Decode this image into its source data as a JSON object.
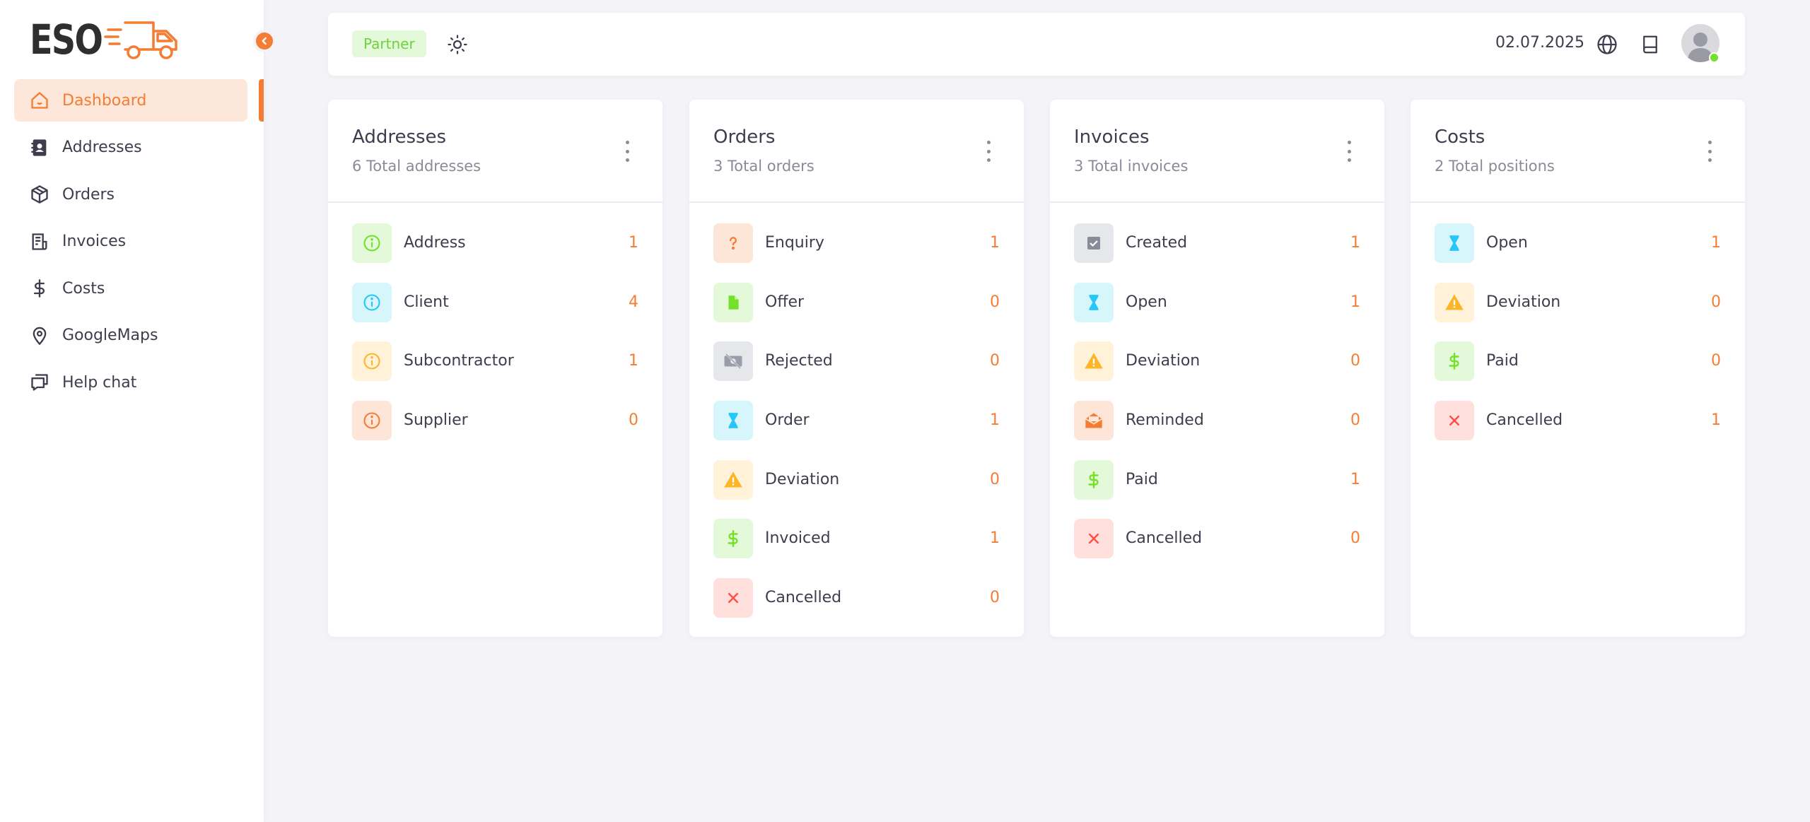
{
  "brand": {
    "name": "ESO",
    "accent": "#f47c33"
  },
  "sidebar": {
    "items": [
      {
        "label": "Dashboard",
        "icon": "home-icon",
        "active": true
      },
      {
        "label": "Addresses",
        "icon": "contacts-book-icon"
      },
      {
        "label": "Orders",
        "icon": "box-icon"
      },
      {
        "label": "Invoices",
        "icon": "invoice-icon"
      },
      {
        "label": "Costs",
        "icon": "dollar-icon"
      },
      {
        "label": "GoogleMaps",
        "icon": "map-pin-icon"
      },
      {
        "label": "Help chat",
        "icon": "chat-icon"
      }
    ]
  },
  "topbar": {
    "badge": "Partner",
    "date": "02.07.2025",
    "icons": [
      "sun-icon",
      "globe-icon",
      "book-icon",
      "avatar"
    ]
  },
  "cards": [
    {
      "title": "Addresses",
      "subtitle": "6 Total addresses",
      "rows": [
        {
          "label": "Address",
          "count": "1",
          "icon": "info-icon",
          "tone": "green"
        },
        {
          "label": "Client",
          "count": "4",
          "icon": "info-icon",
          "tone": "cyan"
        },
        {
          "label": "Subcontractor",
          "count": "1",
          "icon": "info-icon",
          "tone": "yellow"
        },
        {
          "label": "Supplier",
          "count": "0",
          "icon": "info-icon",
          "tone": "orange"
        }
      ]
    },
    {
      "title": "Orders",
      "subtitle": "3 Total orders",
      "rows": [
        {
          "label": "Enquiry",
          "count": "1",
          "icon": "question-icon",
          "tone": "orange"
        },
        {
          "label": "Offer",
          "count": "0",
          "icon": "document-icon",
          "tone": "green"
        },
        {
          "label": "Rejected",
          "count": "0",
          "icon": "money-off-icon",
          "tone": "gray"
        },
        {
          "label": "Order",
          "count": "1",
          "icon": "hourglass-icon",
          "tone": "cyan"
        },
        {
          "label": "Deviation",
          "count": "0",
          "icon": "warning-icon",
          "tone": "yellow"
        },
        {
          "label": "Invoiced",
          "count": "1",
          "icon": "dollar-icon",
          "tone": "green"
        },
        {
          "label": "Cancelled",
          "count": "0",
          "icon": "close-icon",
          "tone": "red"
        }
      ]
    },
    {
      "title": "Invoices",
      "subtitle": "3 Total invoices",
      "rows": [
        {
          "label": "Created",
          "count": "1",
          "icon": "checkbox-icon",
          "tone": "gray"
        },
        {
          "label": "Open",
          "count": "1",
          "icon": "hourglass-icon",
          "tone": "cyan"
        },
        {
          "label": "Deviation",
          "count": "0",
          "icon": "warning-icon",
          "tone": "yellow"
        },
        {
          "label": "Reminded",
          "count": "0",
          "icon": "mail-open-icon",
          "tone": "orange"
        },
        {
          "label": "Paid",
          "count": "1",
          "icon": "dollar-icon",
          "tone": "green"
        },
        {
          "label": "Cancelled",
          "count": "0",
          "icon": "close-icon",
          "tone": "red"
        }
      ]
    },
    {
      "title": "Costs",
      "subtitle": "2 Total positions",
      "rows": [
        {
          "label": "Open",
          "count": "1",
          "icon": "hourglass-icon",
          "tone": "cyan"
        },
        {
          "label": "Deviation",
          "count": "0",
          "icon": "warning-icon",
          "tone": "yellow"
        },
        {
          "label": "Paid",
          "count": "0",
          "icon": "dollar-icon",
          "tone": "green"
        },
        {
          "label": "Cancelled",
          "count": "1",
          "icon": "close-icon",
          "tone": "red"
        }
      ]
    }
  ]
}
